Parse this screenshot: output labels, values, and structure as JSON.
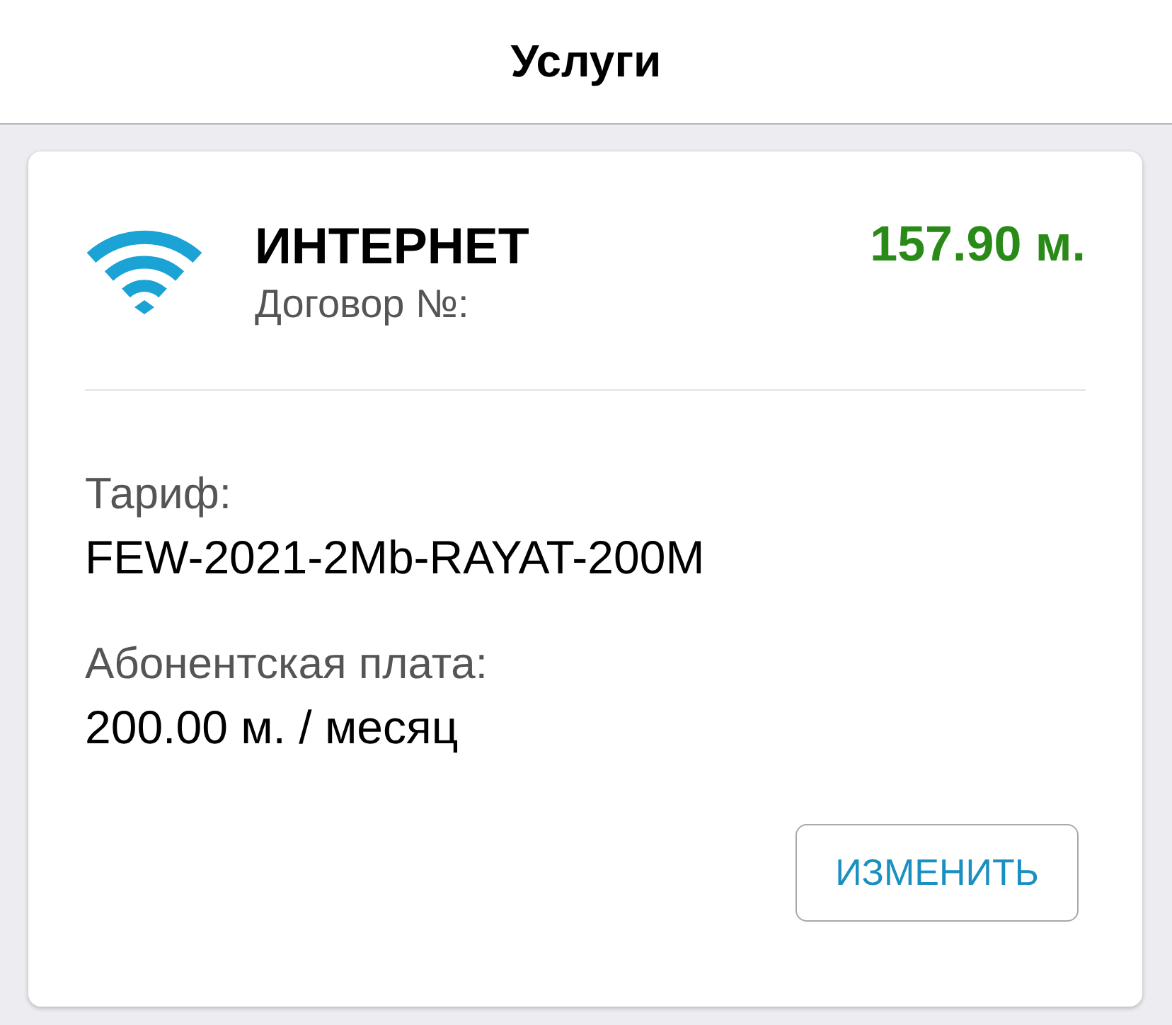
{
  "header": {
    "title": "Услуги"
  },
  "services": [
    {
      "kind": "internet",
      "name": "ИНТЕРНЕТ",
      "contract_label": "Договор №:",
      "balance": "157.90 м.",
      "fields": [
        {
          "label": "Тариф:",
          "value": "FEW-2021-2Mb-RAYAT-200M"
        },
        {
          "label": "Абонентская плата:",
          "value": "200.00 м. / месяц"
        }
      ],
      "action": "ИЗМЕНИТЬ"
    }
  ]
}
